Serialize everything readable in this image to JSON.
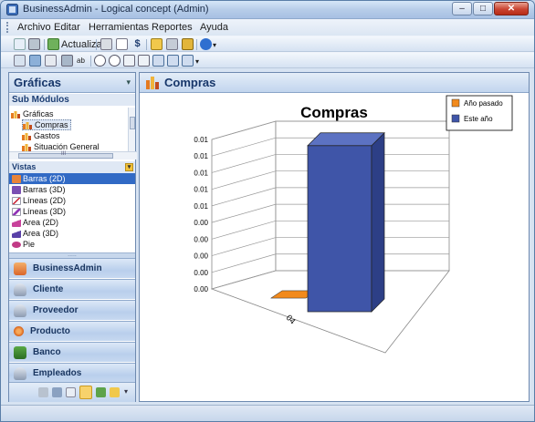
{
  "window": {
    "title": "BusinessAdmin - Logical concept (Admin)"
  },
  "menubar": {
    "items": [
      "Archivo",
      "Editar",
      "Herramientas",
      "Reportes",
      "Ayuda"
    ]
  },
  "toolbar": {
    "actualizar_label": "Actualizar"
  },
  "left_pane": {
    "title": "Gráficas",
    "sub_modulos_label": "Sub Módulos",
    "tree": {
      "root": "Gráficas",
      "children": [
        "Compras",
        "Gastos",
        "Situación General"
      ],
      "selected": "Compras"
    },
    "hscroll_label": "III",
    "vistas_label": "Vistas",
    "vistas": [
      "Barras (2D)",
      "Barras (3D)",
      "Líneas (2D)",
      "Líneas (3D)",
      "Area (2D)",
      "Area (3D)",
      "Pie"
    ],
    "vistas_selected": "Barras (2D)",
    "splitter_label": ".....",
    "nav_buttons": [
      "BusinessAdmin",
      "Cliente",
      "Proveedor",
      "Producto",
      "Banco",
      "Empleados"
    ]
  },
  "right_pane": {
    "title": "Compras"
  },
  "chart_data": {
    "type": "bar",
    "title": "Compras",
    "categories": [
      "04"
    ],
    "series": [
      {
        "name": "Año pasado",
        "values": [
          0.0005
        ],
        "color": "#f28a1c"
      },
      {
        "name": "Este año",
        "values": [
          0.0135
        ],
        "color": "#3f55a8"
      }
    ],
    "y_tick_labels": [
      "0.00",
      "0.00",
      "0.00",
      "0.00",
      "0.00",
      "0.01",
      "0.01",
      "0.01",
      "0.01",
      "0.01"
    ],
    "ylim": [
      0,
      0.014
    ],
    "legend": "top-right",
    "grid": true,
    "three_d": true
  }
}
